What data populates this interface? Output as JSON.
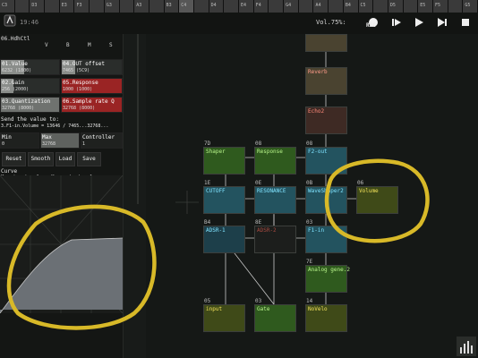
{
  "piano": {
    "keys": [
      "C3",
      "",
      "D3",
      "",
      "E3",
      "F3",
      "",
      "G3",
      "",
      "A3",
      "",
      "B3",
      "C4",
      "",
      "D4",
      "",
      "E4",
      "F4",
      "",
      "G4",
      "",
      "A4",
      "",
      "B4",
      "C5",
      "",
      "D5",
      "",
      "E5",
      "F5",
      "",
      "G5"
    ]
  },
  "topbar": {
    "bpm": "19:46",
    "volume": "Vol.75%:",
    "rec_label": "REC"
  },
  "left_panel": {
    "title": "06.HdhCtl",
    "headers": {
      "v": "V",
      "b": "B",
      "m": "M",
      "s": "S"
    },
    "params": [
      {
        "label": "01.Value",
        "value": "6232 (1800)"
      },
      {
        "label": "04.OUT offset",
        "value": "7465 (5C9)"
      },
      {
        "label": "02.Gain",
        "value": "256 (2000)"
      },
      {
        "label": "05.Response",
        "value": "1000 (1000)"
      },
      {
        "label": "03.Quantization",
        "value": "32768 (8000)"
      },
      {
        "label": "06.Sample rate Q",
        "value": "32768 (8000)"
      }
    ],
    "send_label": "Send the value to:",
    "send_value": "3.F1-in.Volume = 13646 / 7465...32768...",
    "min_label": "Min",
    "min_value": "0",
    "max_label": "Max",
    "max_value": "32768",
    "controller_label": "Controller",
    "controller_value": "1",
    "buttons": [
      "Reset",
      "Smooth",
      "Load",
      "Save"
    ],
    "curve_title": "Curve",
    "curve_desc": "X = input value; Y = output value"
  },
  "nodes": [
    {
      "id": "",
      "name": "Reverb"
    },
    {
      "id": "",
      "name": "Echo2"
    },
    {
      "id": "08",
      "name": "F2-out"
    },
    {
      "id": "7D",
      "name": "Shaper"
    },
    {
      "id": "08",
      "name": "Response"
    },
    {
      "id": "06",
      "name": "Volume"
    },
    {
      "id": "1E",
      "name": "CUTOFF"
    },
    {
      "id": "0E",
      "name": "RESONANCE"
    },
    {
      "id": "0B",
      "name": "WaveShaper2"
    },
    {
      "id": "B4",
      "name": "ADSR-1"
    },
    {
      "id": "8E",
      "name": "ADSR-2"
    },
    {
      "id": "03",
      "name": "F1-in"
    },
    {
      "id": "7E",
      "name": "Analog gene.2"
    },
    {
      "id": "05",
      "name": "input"
    },
    {
      "id": "03",
      "name": "Gate"
    },
    {
      "id": "14",
      "name": "NoVelo"
    }
  ],
  "colors": {
    "node_green": "#2f5a1e",
    "node_teal": "#23535f",
    "node_olive": "#3f4a18",
    "node_brown_dark": "#3e2a24",
    "node_brown": "#4a4330",
    "highlight_yellow": "#d8b928",
    "graph_fill": "#6b7075",
    "text_green": "#aef07a",
    "text_cyan": "#7fe3ff",
    "text_yellow": "#f2e25a",
    "text_red": "#ff7b6b"
  }
}
